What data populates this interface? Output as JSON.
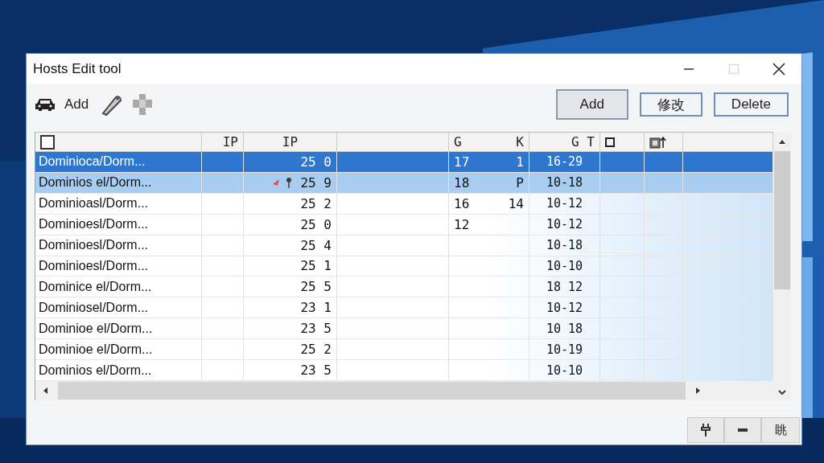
{
  "window": {
    "title": "Hosts Edit tool",
    "maximize_disabled": true
  },
  "toolbar": {
    "label": "Add",
    "buttons": [
      {
        "label": "Add",
        "pressed": true
      },
      {
        "label": "修改",
        "pressed": false
      },
      {
        "label": "Delete",
        "pressed": false
      }
    ]
  },
  "table": {
    "header_checked": false,
    "columns": [
      {
        "label": "IP"
      },
      {
        "label": "IP"
      },
      {
        "label": "G"
      },
      {
        "label": "K"
      },
      {
        "label": "G T"
      }
    ],
    "rows": [
      {
        "name": "Dominioca/Dorm...",
        "ip": "25 0",
        "g": "17",
        "k": "1",
        "date": "16-29",
        "selected": true,
        "hover": false,
        "marker": false
      },
      {
        "name": "Dominios el/Dorm...",
        "ip": "25 9",
        "g": "18",
        "k": "P",
        "date": "10-18",
        "selected": false,
        "hover": true,
        "marker": true
      },
      {
        "name": "Dominioasl/Dorm...",
        "ip": "25 2",
        "g": "16",
        "k": "14",
        "date": "10-12",
        "selected": false,
        "hover": false,
        "marker": false
      },
      {
        "name": "Dominioesl/Dorm...",
        "ip": "25 0",
        "g": "12",
        "date": "10-12",
        "selected": false,
        "hover": false,
        "marker": false
      },
      {
        "name": "Dominioesl/Dorm...",
        "ip": "25 4",
        "date": "10-18",
        "selected": false,
        "hover": false,
        "marker": false
      },
      {
        "name": "Dominioesl/Dorm...",
        "ip": "25 1",
        "date": "10-10",
        "selected": false,
        "hover": false,
        "marker": false
      },
      {
        "name": "Dominice el/Dorm...",
        "ip": "25 5",
        "date": "18 12",
        "selected": false,
        "hover": false,
        "marker": false
      },
      {
        "name": "Dominiosel/Dorm...",
        "ip": "23 1",
        "date": "10-12",
        "selected": false,
        "hover": false,
        "marker": false
      },
      {
        "name": "Dominioe el/Dorm...",
        "ip": "23 5",
        "date": "10 18",
        "selected": false,
        "hover": false,
        "marker": false
      },
      {
        "name": "Dominioe el/Dorm...",
        "ip": "25 2",
        "date": "10-19",
        "selected": false,
        "hover": false,
        "marker": false
      },
      {
        "name": "Dominios el/Dorm...",
        "ip": "23 5",
        "date": "10-10",
        "selected": false,
        "hover": false,
        "marker": false
      }
    ]
  },
  "status_bar": {
    "label": "眺"
  }
}
